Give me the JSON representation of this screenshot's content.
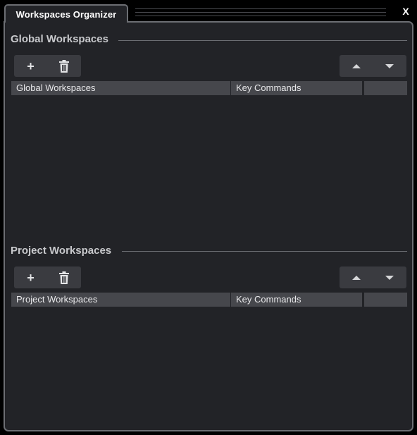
{
  "window": {
    "tab_title": "Workspaces Organizer",
    "close_label": "X"
  },
  "global_section": {
    "title": "Global Workspaces",
    "toolbar": {
      "add": "+",
      "delete_icon": "trash-icon",
      "move_up_icon": "arrow-up-icon",
      "move_down_icon": "arrow-down-icon"
    },
    "columns": [
      "Global Workspaces",
      "Key Commands",
      ""
    ],
    "rows": []
  },
  "project_section": {
    "title": "Project Workspaces",
    "toolbar": {
      "add": "+",
      "delete_icon": "trash-icon",
      "move_up_icon": "arrow-up-icon",
      "move_down_icon": "arrow-down-icon"
    },
    "columns": [
      "Project Workspaces",
      "Key Commands",
      ""
    ],
    "rows": []
  },
  "colors": {
    "background": "#000000",
    "panel": "#222327",
    "border": "#6c6e73",
    "button": "#3a3b40",
    "table_header": "#46474c",
    "text": "#ffffff"
  }
}
